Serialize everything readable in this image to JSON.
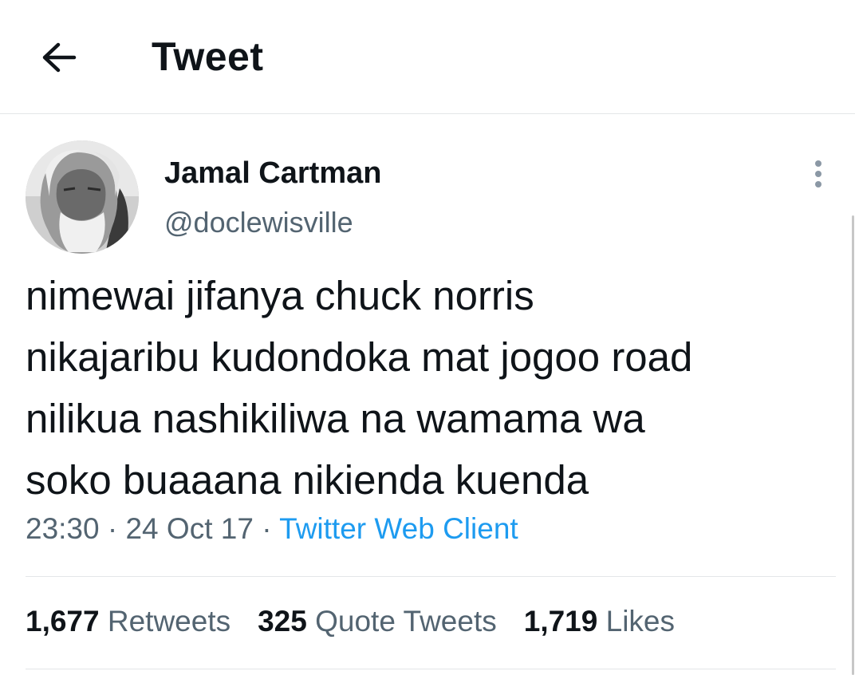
{
  "header": {
    "title": "Tweet",
    "back_icon": "arrow-left-icon"
  },
  "tweet": {
    "author": {
      "display_name": "Jamal Cartman",
      "handle": "@doclewisville"
    },
    "text": "nimewai jifanya chuck norris\nnikajaribu kudondoka mat jogoo road\nnilikua nashikiliwa na wamama wa\nsoko buaaana nikienda kuenda",
    "time": "23:30",
    "date": "24 Oct 17",
    "separator": "·",
    "client": "Twitter Web Client",
    "more_icon": "more-vertical-icon"
  },
  "stats": {
    "retweets": {
      "count": "1,677",
      "label": "Retweets"
    },
    "quotes": {
      "count": "325",
      "label": "Quote Tweets"
    },
    "likes": {
      "count": "1,719",
      "label": "Likes"
    }
  },
  "colors": {
    "accent": "#1d9bf0",
    "secondary_text": "#536471",
    "primary_text": "#0f1419",
    "divider": "#e3e6e8"
  }
}
